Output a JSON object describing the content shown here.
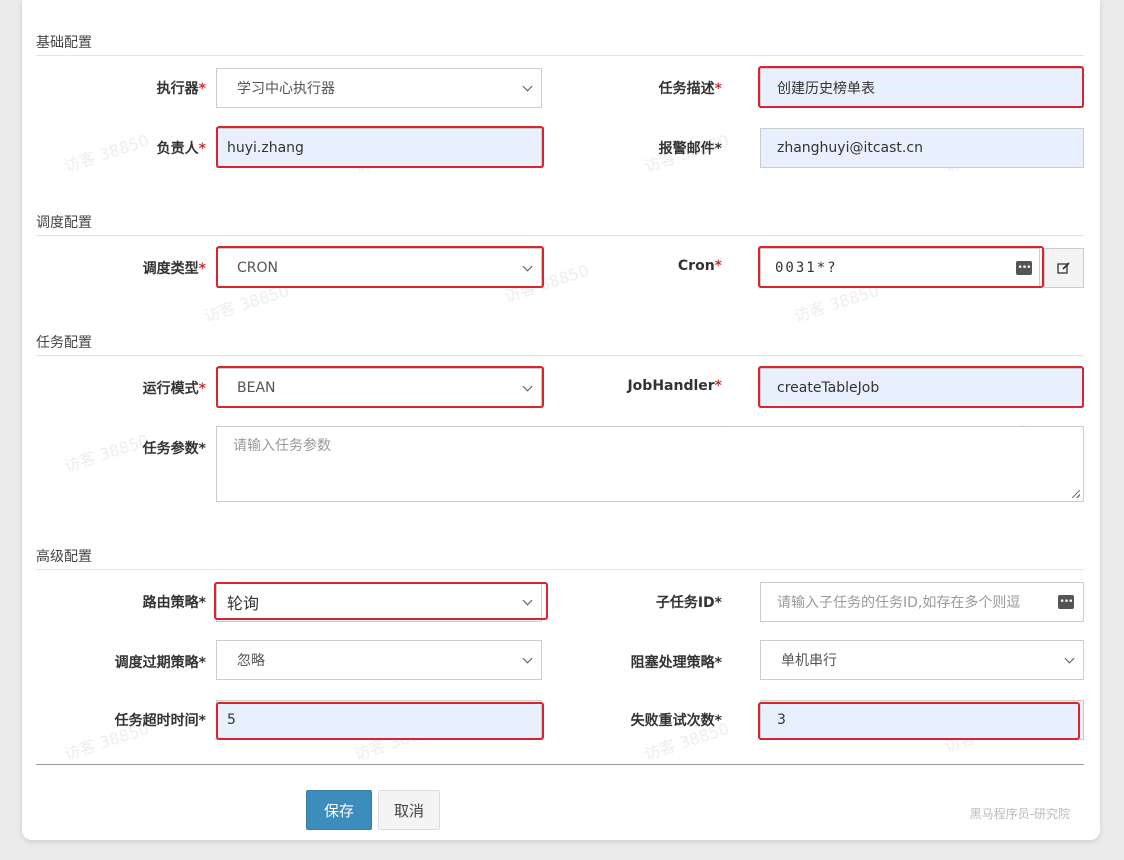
{
  "sections": {
    "basic": "基础配置",
    "schedule": "调度配置",
    "task": "任务配置",
    "advanced": "高级配置"
  },
  "basic": {
    "executor_label": "执行器",
    "executor_value": "学习中心执行器",
    "desc_label": "任务描述",
    "desc_value": "创建历史榜单表",
    "owner_label": "负责人",
    "owner_value": "huyi.zhang",
    "email_label": "报警邮件",
    "email_value": "zhanghuyi@itcast.cn"
  },
  "schedule": {
    "type_label": "调度类型",
    "type_value": "CRON",
    "cron_label": "Cron",
    "cron_value": "0031*?"
  },
  "task": {
    "mode_label": "运行模式",
    "mode_value": "BEAN",
    "handler_label": "JobHandler",
    "handler_value": "createTableJob",
    "params_label": "任务参数",
    "params_placeholder": "请输入任务参数"
  },
  "advanced": {
    "route_label": "路由策略",
    "route_value": "轮询",
    "child_label": "子任务ID",
    "child_placeholder": "请输入子任务的任务ID,如存在多个则逗",
    "expire_label": "调度过期策略",
    "expire_value": "忽略",
    "block_label": "阻塞处理策略",
    "block_value": "单机串行",
    "timeout_label": "任务超时时间",
    "timeout_value": "5",
    "retry_label": "失败重试次数",
    "retry_value": "3"
  },
  "buttons": {
    "save": "保存",
    "cancel": "取消"
  },
  "watermark": "访客 38850",
  "corner_watermark": "黑马程序员-研究院",
  "required_mark": "*",
  "colors": {
    "highlight_border": "#d9232d",
    "filled_field_bg": "#e8f0fe",
    "save_button": "#3c8dbc",
    "required": "#cc3333"
  }
}
